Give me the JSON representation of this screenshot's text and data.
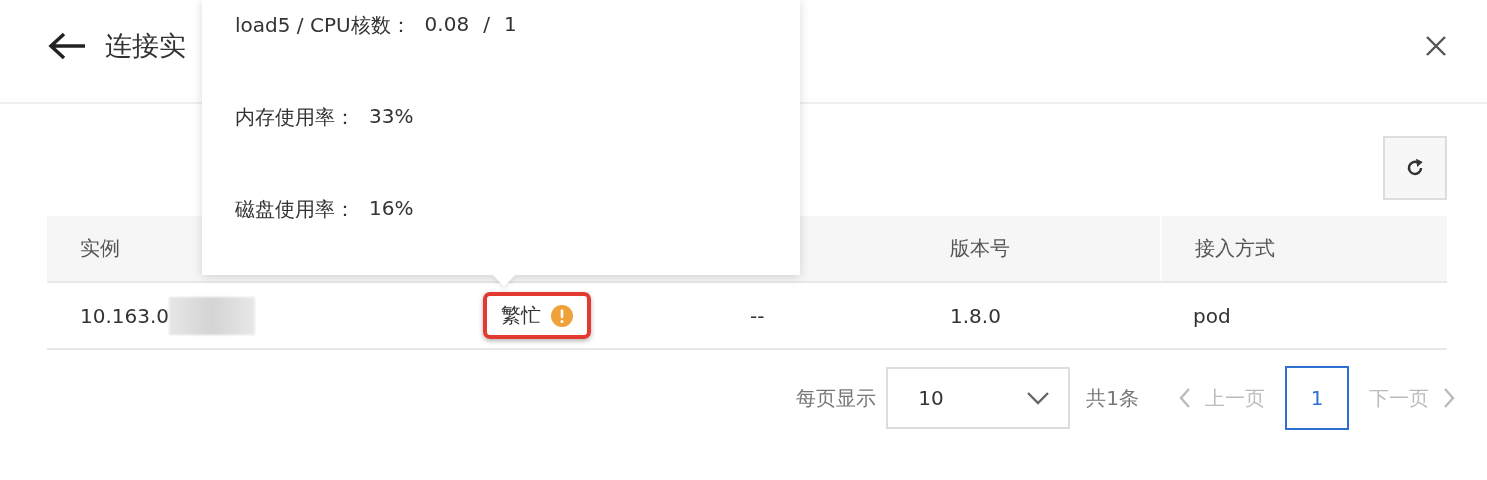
{
  "header": {
    "title": "连接实"
  },
  "table": {
    "columns": [
      "实例",
      "版本号",
      "接入方式"
    ],
    "rows": [
      {
        "instance": "10.163.0",
        "status": {
          "text": "繁忙",
          "highlighted": true
        },
        "column_3": "--",
        "version": "1.8.0",
        "access": "pod"
      }
    ]
  },
  "tooltip": {
    "lines": [
      {
        "label": "load5 / CPU核数：",
        "values": [
          "0.08",
          "/",
          "1"
        ]
      },
      {
        "label": "内存使用率：",
        "values": [
          "33%"
        ]
      },
      {
        "label": "磁盘使用率：",
        "values": [
          "16%"
        ]
      }
    ]
  },
  "pagination": {
    "page_size_label": "每页显示",
    "page_size": "10",
    "total": "共1条",
    "prev": {
      "label": "上一页",
      "disabled": true
    },
    "pages": [
      {
        "label": "1",
        "selected": true
      }
    ],
    "next": {
      "label": "下一页",
      "disabled": true
    }
  }
}
